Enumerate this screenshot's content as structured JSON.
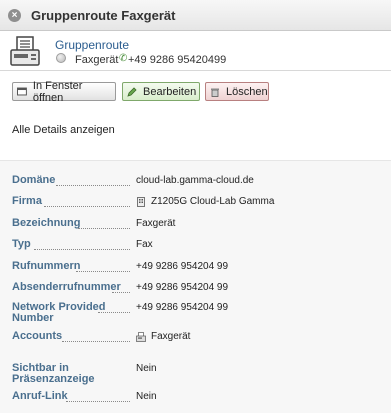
{
  "window": {
    "title": "Gruppenroute Faxgerät"
  },
  "header": {
    "name": "Gruppenroute",
    "type": "Faxgerät",
    "number": "+49 9286 95420499"
  },
  "actions": {
    "open_window": "In Fenster öffnen",
    "edit": "Bearbeiten",
    "delete": "Löschen"
  },
  "details_link": "Alle Details anzeigen",
  "details": {
    "domain": {
      "label": "Domäne",
      "value": "cloud-lab.gamma-cloud.de"
    },
    "company": {
      "label": "Firma",
      "value": "Z1205G Cloud-Lab Gamma"
    },
    "description": {
      "label": "Bezeichnung",
      "value": "Faxgerät"
    },
    "type": {
      "label": "Typ",
      "value": "Fax"
    },
    "numbers": {
      "label": "Rufnummern",
      "value": "+49 9286 954204 99"
    },
    "sender_number": {
      "label": "Absenderrufnummer",
      "value": "+49 9286 954204 99"
    },
    "network_number": {
      "label": "Network Provided Number",
      "value": "+49 9286 954204 99"
    },
    "accounts": {
      "label": "Accounts",
      "value": "Faxgerät"
    },
    "presence": {
      "label": "Sichtbar in Präsenzanzeige",
      "value": "Nein"
    },
    "call_link": {
      "label": "Anruf-Link",
      "value": "Nein"
    }
  }
}
